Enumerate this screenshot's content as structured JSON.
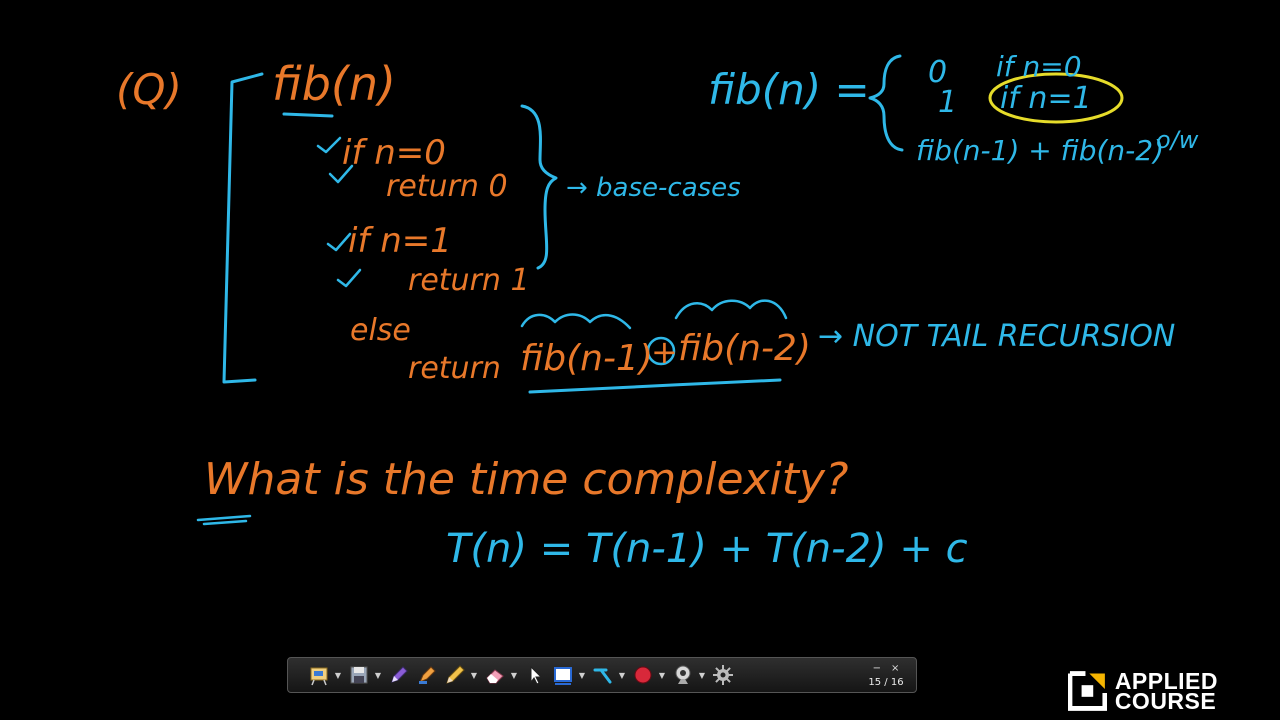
{
  "board": {
    "question_marker": "(Q)",
    "code": {
      "header": "fib(n)",
      "line1": "if n=0",
      "line2": "return 0",
      "line3": "if n=1",
      "line4": "return 1",
      "line5": "else",
      "line6_return": "return",
      "line6_call1": "fib(n-1)",
      "line6_plus": "+",
      "line6_call2": "fib(n-2)"
    },
    "base_cases_note": "→ base-cases",
    "not_tail_note": "→ NOT TAIL RECURSION",
    "definition": {
      "lhs": "fib(n) =",
      "case0_value": "0",
      "case0_cond": "if n=0",
      "case1_value": "1",
      "case1_cond": "if n=1",
      "case2_value": "fib(n-1) + fib(n-2)",
      "case2_cond": "o/w"
    },
    "question": "What is the time complexity?",
    "recurrence": "T(n) = T(n-1) + T(n-2) + c",
    "colors": {
      "orange": "#e8782a",
      "cyan": "#2fb8e8",
      "yellow": "#e6dc2a",
      "background": "#000000"
    }
  },
  "toolbar": {
    "tools": [
      {
        "name": "presentation-tool",
        "icon": "presentation-icon"
      },
      {
        "name": "save-tool",
        "icon": "floppy-icon"
      },
      {
        "name": "pen-tool",
        "icon": "pen-icon"
      },
      {
        "name": "highlighter-tool",
        "icon": "highlighter-icon"
      },
      {
        "name": "pencil-tool",
        "icon": "pencil-icon"
      },
      {
        "name": "eraser-tool",
        "icon": "eraser-icon"
      },
      {
        "name": "pointer-tool",
        "icon": "cursor-icon"
      },
      {
        "name": "shape-tool",
        "icon": "rectangle-icon"
      },
      {
        "name": "line-tool",
        "icon": "line-icon"
      },
      {
        "name": "record-tool",
        "icon": "record-icon"
      },
      {
        "name": "webcam-tool",
        "icon": "webcam-icon"
      },
      {
        "name": "settings-tool",
        "icon": "gear-icon"
      }
    ],
    "minimize_label": "−",
    "close_label": "×",
    "page_indicator": "15 / 16"
  },
  "brand": {
    "line1": "APPLIED",
    "line2": "COURSE"
  }
}
